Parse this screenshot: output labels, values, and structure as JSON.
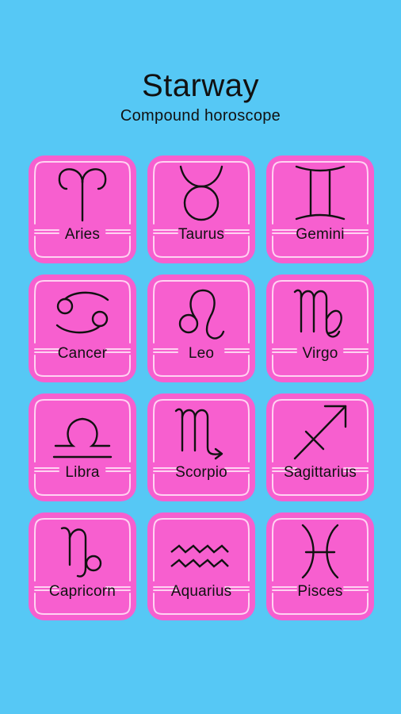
{
  "app": {
    "title": "Starway",
    "subtitle": "Compound horoscope"
  },
  "colors": {
    "background": "#56c8f5",
    "tile": "#f75fcf",
    "tile_frame": "#ffd3f2",
    "text": "#111111"
  },
  "signs": [
    {
      "label": "Aries",
      "icon": "aries-icon"
    },
    {
      "label": "Taurus",
      "icon": "taurus-icon"
    },
    {
      "label": "Gemini",
      "icon": "gemini-icon"
    },
    {
      "label": "Cancer",
      "icon": "cancer-icon"
    },
    {
      "label": "Leo",
      "icon": "leo-icon"
    },
    {
      "label": "Virgo",
      "icon": "virgo-icon"
    },
    {
      "label": "Libra",
      "icon": "libra-icon"
    },
    {
      "label": "Scorpio",
      "icon": "scorpio-icon"
    },
    {
      "label": "Sagittarius",
      "icon": "sagittarius-icon"
    },
    {
      "label": "Capricorn",
      "icon": "capricorn-icon"
    },
    {
      "label": "Aquarius",
      "icon": "aquarius-icon"
    },
    {
      "label": "Pisces",
      "icon": "pisces-icon"
    }
  ]
}
